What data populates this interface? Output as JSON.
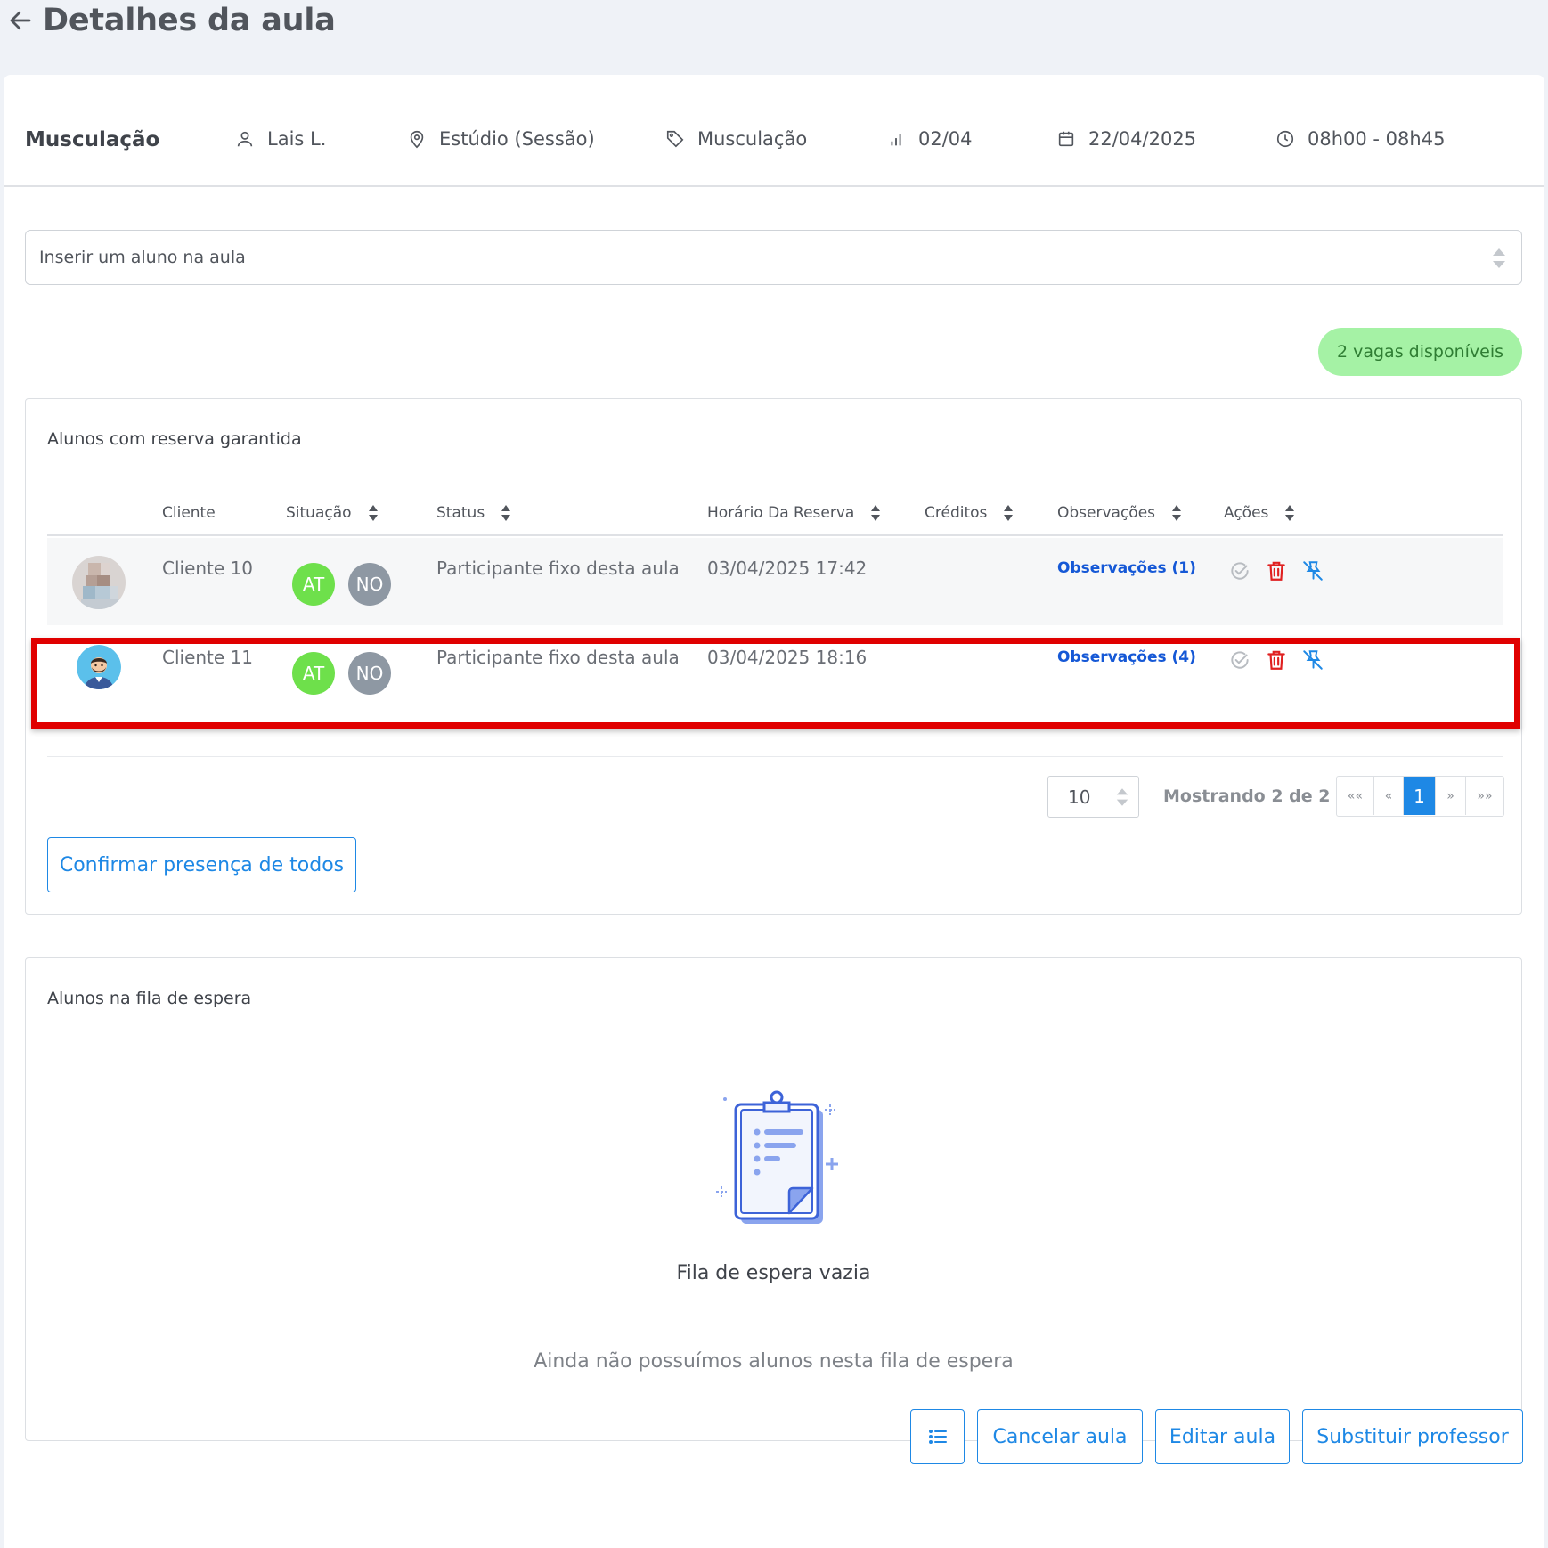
{
  "header": {
    "title": "Detalhes da aula"
  },
  "info": {
    "class_name": "Musculação",
    "teacher": "Lais L.",
    "location": "Estúdio (Sessão)",
    "modality": "Musculação",
    "occupancy": "02/04",
    "date": "22/04/2025",
    "time": "08h00 - 08h45"
  },
  "insert_select": {
    "placeholder": "Inserir um aluno na aula"
  },
  "vagas_badge": "2 vagas disponíveis",
  "reserved": {
    "title": "Alunos com reserva garantida",
    "columns": [
      "Cliente",
      "Situação",
      "Status",
      "Horário Da Reserva",
      "Créditos",
      "Observações",
      "Ações"
    ],
    "rows": [
      {
        "client": "Cliente 10",
        "situation": [
          "AT",
          "NO"
        ],
        "status": "Participante fixo desta aula",
        "reserved_at": "03/04/2025 17:42",
        "credits": "",
        "notes": "Observações (1)"
      },
      {
        "client": "Cliente 11",
        "situation": [
          "AT",
          "NO"
        ],
        "status": "Participante fixo desta aula",
        "reserved_at": "03/04/2025 18:16",
        "credits": "",
        "notes": "Observações (4)"
      }
    ],
    "page_size": "10",
    "showing": "Mostrando 2 de 2",
    "pager": {
      "first": "««",
      "prev": "«",
      "current": "1",
      "next": "»",
      "last": "»»"
    },
    "confirm_all": "Confirmar presença de todos"
  },
  "waitlist": {
    "title": "Alunos na fila de espera",
    "empty_title": "Fila de espera vazia",
    "empty_subtitle": "Ainda não possuímos alunos nesta fila de espera"
  },
  "footer": {
    "cancel": "Cancelar aula",
    "edit": "Editar aula",
    "replace_teacher": "Substituir professor"
  },
  "colors": {
    "accent": "#1e88e5",
    "badge_bg": "#a5f2a5",
    "at": "#6ee04b",
    "no": "#8e98a3",
    "danger": "#e02020",
    "highlight": "#e00000"
  }
}
